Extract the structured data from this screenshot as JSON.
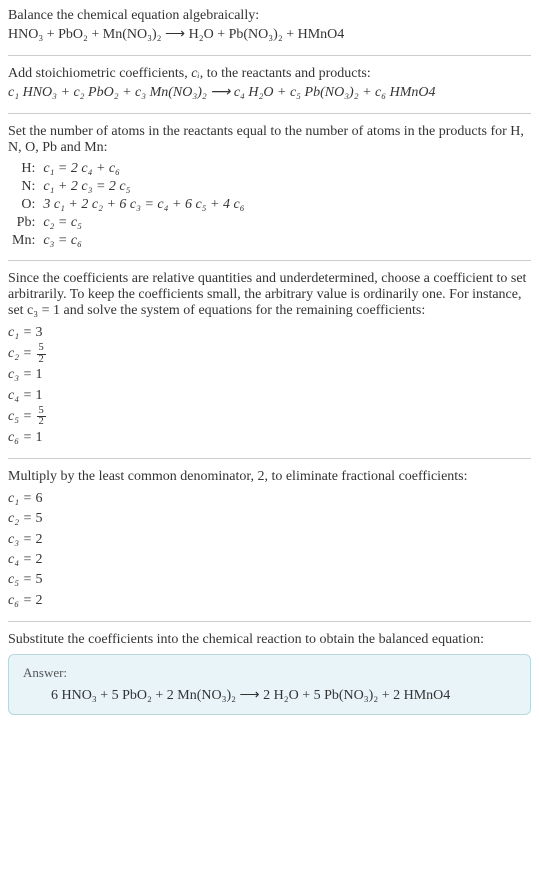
{
  "s1": {
    "intro": "Balance the chemical equation algebraically:",
    "eq": "HNO₃ + PbO₂ + Mn(NO₃)₂  ⟶  H₂O + Pb(NO₃)₂ + HMnO4"
  },
  "s2": {
    "intro_a": "Add stoichiometric coefficients, ",
    "ci": "cᵢ",
    "intro_b": ", to the reactants and products:",
    "eq": "c₁ HNO₃ + c₂ PbO₂ + c₃ Mn(NO₃)₂  ⟶  c₄ H₂O + c₅ Pb(NO₃)₂ + c₆ HMnO4"
  },
  "s3": {
    "intro": "Set the number of atoms in the reactants equal to the number of atoms in the products for H, N, O, Pb and Mn:",
    "rows": [
      {
        "el": "H:",
        "eq": "c₁ = 2 c₄ + c₆"
      },
      {
        "el": "N:",
        "eq": "c₁ + 2 c₃ = 2 c₅"
      },
      {
        "el": "O:",
        "eq": "3 c₁ + 2 c₂ + 6 c₃ = c₄ + 6 c₅ + 4 c₆"
      },
      {
        "el": "Pb:",
        "eq": "c₂ = c₅"
      },
      {
        "el": "Mn:",
        "eq": "c₃ = c₆"
      }
    ]
  },
  "s4": {
    "intro": "Since the coefficients are relative quantities and underdetermined, choose a coefficient to set arbitrarily. To keep the coefficients small, the arbitrary value is ordinarily one. For instance, set c₃ = 1 and solve the system of equations for the remaining coefficients:",
    "coeffs": [
      {
        "lhs": "c₁ =",
        "rhs": "3"
      },
      {
        "lhs": "c₂ =",
        "frac_num": "5",
        "frac_den": "2"
      },
      {
        "lhs": "c₃ =",
        "rhs": "1"
      },
      {
        "lhs": "c₄ =",
        "rhs": "1"
      },
      {
        "lhs": "c₅ =",
        "frac_num": "5",
        "frac_den": "2"
      },
      {
        "lhs": "c₆ =",
        "rhs": "1"
      }
    ]
  },
  "s5": {
    "intro": "Multiply by the least common denominator, 2, to eliminate fractional coefficients:",
    "coeffs": [
      {
        "lhs": "c₁ =",
        "rhs": "6"
      },
      {
        "lhs": "c₂ =",
        "rhs": "5"
      },
      {
        "lhs": "c₃ =",
        "rhs": "2"
      },
      {
        "lhs": "c₄ =",
        "rhs": "2"
      },
      {
        "lhs": "c₅ =",
        "rhs": "5"
      },
      {
        "lhs": "c₆ =",
        "rhs": "2"
      }
    ]
  },
  "s6": {
    "intro": "Substitute the coefficients into the chemical reaction to obtain the balanced equation:",
    "answer_label": "Answer:",
    "answer_eq": "6 HNO₃ + 5 PbO₂ + 2 Mn(NO₃)₂  ⟶  2 H₂O + 5 Pb(NO₃)₂ + 2 HMnO4"
  }
}
